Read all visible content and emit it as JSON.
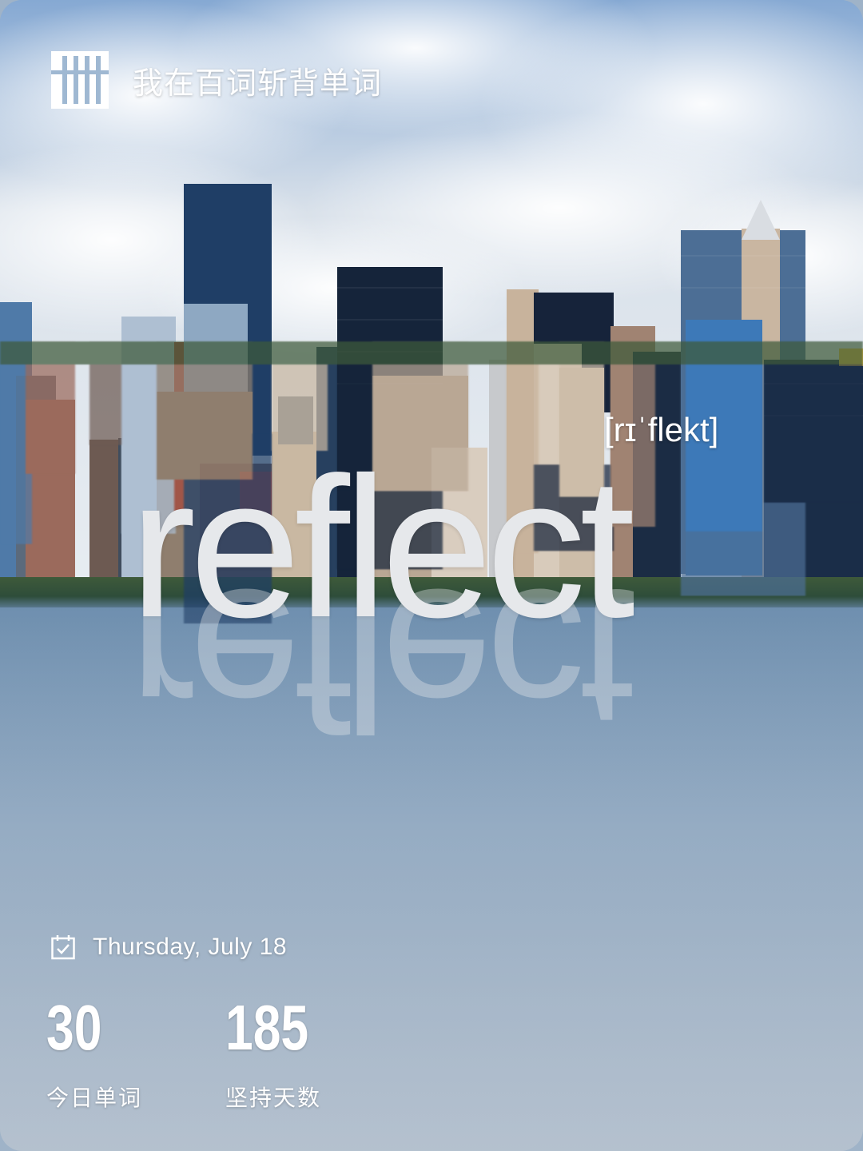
{
  "app": {
    "tagline": "我在百词斩背单词"
  },
  "word": {
    "text": "reflect",
    "phonetic": "[rɪˈflekt]"
  },
  "date": {
    "text": "Thursday, July 18"
  },
  "stats": {
    "today_words": {
      "value": "30",
      "label": "今日单词"
    },
    "streak_days": {
      "value": "185",
      "label": "坚持天数"
    }
  },
  "icons": {
    "logo": "baicizhan-logo-icon",
    "calendar": "calendar-check-icon"
  },
  "colors": {
    "text": "#ffffff",
    "word": "#e6e8eb"
  }
}
